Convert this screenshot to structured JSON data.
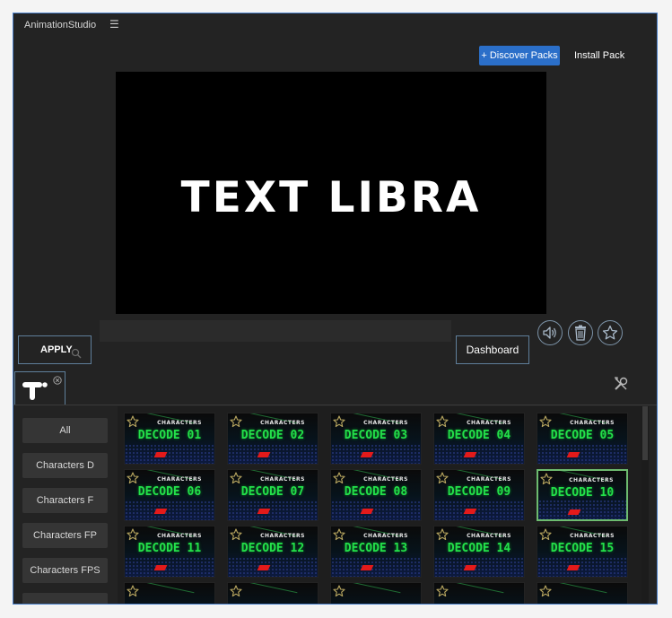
{
  "titlebar": {
    "app_name": "AnimationStudio",
    "menu_icon": "hamburger-icon"
  },
  "header": {
    "discover_label": "+ Discover Packs",
    "install_label": "Install Pack"
  },
  "preview": {
    "text": "TEXT LIBRA"
  },
  "controls": {
    "apply_label": "APPLY",
    "dashboard_label": "Dashboard",
    "icons": [
      "speaker-icon",
      "trash-icon",
      "star-icon"
    ]
  },
  "categories": [
    {
      "label": "All",
      "active": true
    },
    {
      "label": "Characters D"
    },
    {
      "label": "Characters F"
    },
    {
      "label": "Characters FP"
    },
    {
      "label": "Characters FPS"
    }
  ],
  "presets": [
    {
      "top": "CHARACTERS",
      "name": "DECODE 01"
    },
    {
      "top": "CHARACTERS",
      "name": "DECODE 02"
    },
    {
      "top": "CHARACTERS",
      "name": "DECODE 03"
    },
    {
      "top": "CHARACTERS",
      "name": "DECODE 04"
    },
    {
      "top": "CHARACTERS",
      "name": "DECODE 05"
    },
    {
      "top": "CHARACTERS",
      "name": "DECODE 06"
    },
    {
      "top": "CHARACTERS",
      "name": "DECODE 07"
    },
    {
      "top": "CHARACTERS",
      "name": "DECODE 08"
    },
    {
      "top": "CHARACTERS",
      "name": "DECODE 09"
    },
    {
      "top": "CHARACTERS",
      "name": "DECODE 10",
      "selected": true
    },
    {
      "top": "CHARACTERS",
      "name": "DECODE 11"
    },
    {
      "top": "CHARACTERS",
      "name": "DECODE 12"
    },
    {
      "top": "CHARACTERS",
      "name": "DECODE 13"
    },
    {
      "top": "CHARACTERS",
      "name": "DECODE 14"
    },
    {
      "top": "CHARACTERS",
      "name": "DECODE 15"
    },
    {
      "top": "",
      "name": ""
    },
    {
      "top": "",
      "name": ""
    },
    {
      "top": "",
      "name": ""
    },
    {
      "top": "",
      "name": ""
    },
    {
      "top": "",
      "name": ""
    }
  ],
  "colors": {
    "accent": "#2b6fc9",
    "selected_border": "#6dbb6f",
    "preset_text": "#23e04a"
  }
}
